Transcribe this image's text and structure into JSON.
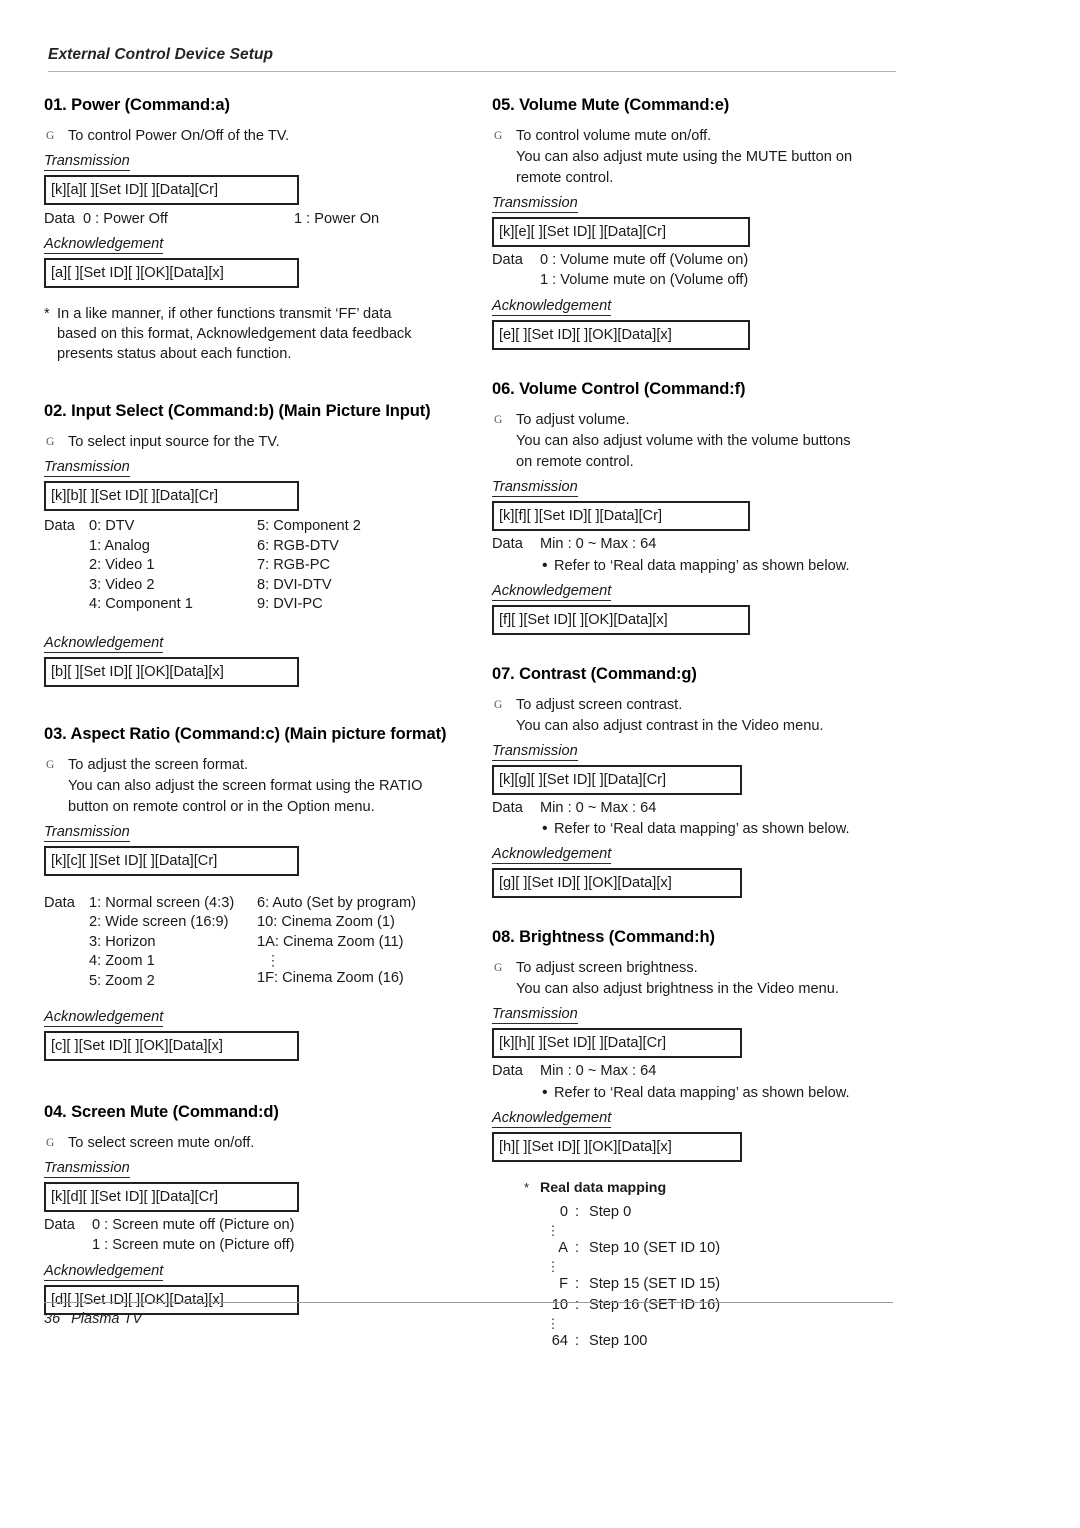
{
  "header": {
    "title": "External Control Device Setup"
  },
  "footer": {
    "page_number": "36",
    "model": "Plasma TV"
  },
  "glyphs": {
    "bullet_arrow": "G",
    "asterisk": "*",
    "round_dot": "•",
    "vertical_dots": "⋮"
  },
  "labels": {
    "transmission": "Transmission",
    "acknowledgement": "Acknowledgement",
    "data": "Data"
  },
  "sections": {
    "power": {
      "title": "01. Power (Command:a)",
      "desc": "To control Power On/Off of the TV.",
      "transmission_code": "[k][a][  ][Set ID][  ][Data][Cr]",
      "data_first": "0  :  Power Off",
      "data_second": "1  :  Power On",
      "ack_code": "[a][  ][Set ID][  ][OK][Data][x]",
      "note_line1": "In a like manner, if other functions transmit ‘FF’ data",
      "note_line2": "based on this format, Acknowledgement data feedback",
      "note_line3": "presents status about each function."
    },
    "input_select": {
      "title": "02. Input Select (Command:b) (Main Picture Input)",
      "desc": "To select input source for the TV.",
      "transmission_code": "[k][b][  ][Set ID][  ][Data][Cr]",
      "data_col_a": [
        "0: DTV",
        "1: Analog",
        "2: Video 1",
        "3: Video 2",
        "4: Component 1"
      ],
      "data_col_b": [
        "5: Component 2",
        "6: RGB-DTV",
        "7: RGB-PC",
        "8: DVI-DTV",
        "9: DVI-PC"
      ],
      "ack_code": "[b][  ][Set ID][  ][OK][Data][x]"
    },
    "aspect_ratio": {
      "title": "03. Aspect Ratio (Command:c) (Main picture format)",
      "desc_line1": "To adjust the screen format.",
      "desc_line2": "You can also adjust the screen format using the RATIO",
      "desc_line3": "button on remote control or in the Option menu.",
      "transmission_code": "[k][c][  ][Set ID][  ][Data][Cr]",
      "data_col_a": [
        "1: Normal screen (4:3)",
        "2: Wide screen (16:9)",
        "3: Horizon",
        "4: Zoom 1",
        "5: Zoom 2"
      ],
      "data_col_b_1": "6: Auto (Set by program)",
      "data_col_b_2": "10: Cinema Zoom (1)",
      "data_col_b_3": "1A: Cinema Zoom (11)",
      "data_col_b_4": "1F: Cinema Zoom (16)",
      "ack_code": "[c][  ][Set ID][  ][OK][Data][x]"
    },
    "screen_mute": {
      "title": "04. Screen Mute (Command:d)",
      "desc": "To select screen mute on/off.",
      "transmission_code": "[k][d][  ][Set ID][  ][Data][Cr]",
      "data_line1": "0  :  Screen mute off (Picture on)",
      "data_line2": "1  :  Screen mute on (Picture off)",
      "ack_code": "[d][  ][Set ID][  ][OK][Data][x]"
    },
    "volume_mute": {
      "title": "05. Volume Mute (Command:e)",
      "desc_line1": "To control volume mute on/off.",
      "desc_line2": "You can also adjust mute using the MUTE button on",
      "desc_line3": "remote control.",
      "transmission_code": "[k][e][  ][Set ID][  ][Data][Cr]",
      "data_line1": "0  :  Volume mute off (Volume on)",
      "data_line2": "1  :  Volume mute on (Volume off)",
      "ack_code": "[e][  ][Set ID][  ][OK][Data][x]"
    },
    "volume_control": {
      "title": "06. Volume Control (Command:f)",
      "desc_line1": "To adjust volume.",
      "desc_line2": "You can also adjust volume with the volume buttons",
      "desc_line3": "on remote control.",
      "transmission_code": "[k][f][  ][Set ID][  ][Data][Cr]",
      "data_range": "Min : 0 ~ Max : 64",
      "refer_note": "Refer to ‘Real data mapping’ as shown below.",
      "ack_code": "[f][  ][Set ID][  ][OK][Data][x]"
    },
    "contrast": {
      "title": "07. Contrast (Command:g)",
      "desc_line1": "To adjust screen contrast.",
      "desc_line2": "You can also adjust contrast in the Video menu.",
      "transmission_code": "[k][g][  ][Set ID][  ][Data][Cr]",
      "data_range": "Min : 0 ~ Max : 64",
      "refer_note": "Refer to ‘Real data mapping’ as shown below.",
      "ack_code": "[g][  ][Set ID][  ][OK][Data][x]"
    },
    "brightness": {
      "title": "08. Brightness (Command:h)",
      "desc_line1": "To adjust screen brightness.",
      "desc_line2": "You can also adjust brightness in the Video menu.",
      "transmission_code": "[k][h][  ][Set ID][  ][Data][Cr]",
      "data_range": "Min : 0 ~ Max : 64",
      "refer_note": "Refer to ‘Real data mapping’ as shown below.",
      "ack_code": "[h][  ][Set ID][  ][OK][Data][x]"
    },
    "real_data_mapping": {
      "title": "Real data mapping",
      "rows": [
        {
          "num": "0",
          "sep": ":",
          "val": "Step 0"
        },
        {
          "num": "A",
          "sep": ":",
          "val": "Step 10 (SET ID 10)"
        },
        {
          "num": "F",
          "sep": ":",
          "val": "Step 15 (SET ID 15)"
        },
        {
          "num": "10",
          "sep": ":",
          "val": "Step 16 (SET ID 16)"
        },
        {
          "num": "64",
          "sep": ":",
          "val": "Step 100"
        }
      ]
    }
  }
}
